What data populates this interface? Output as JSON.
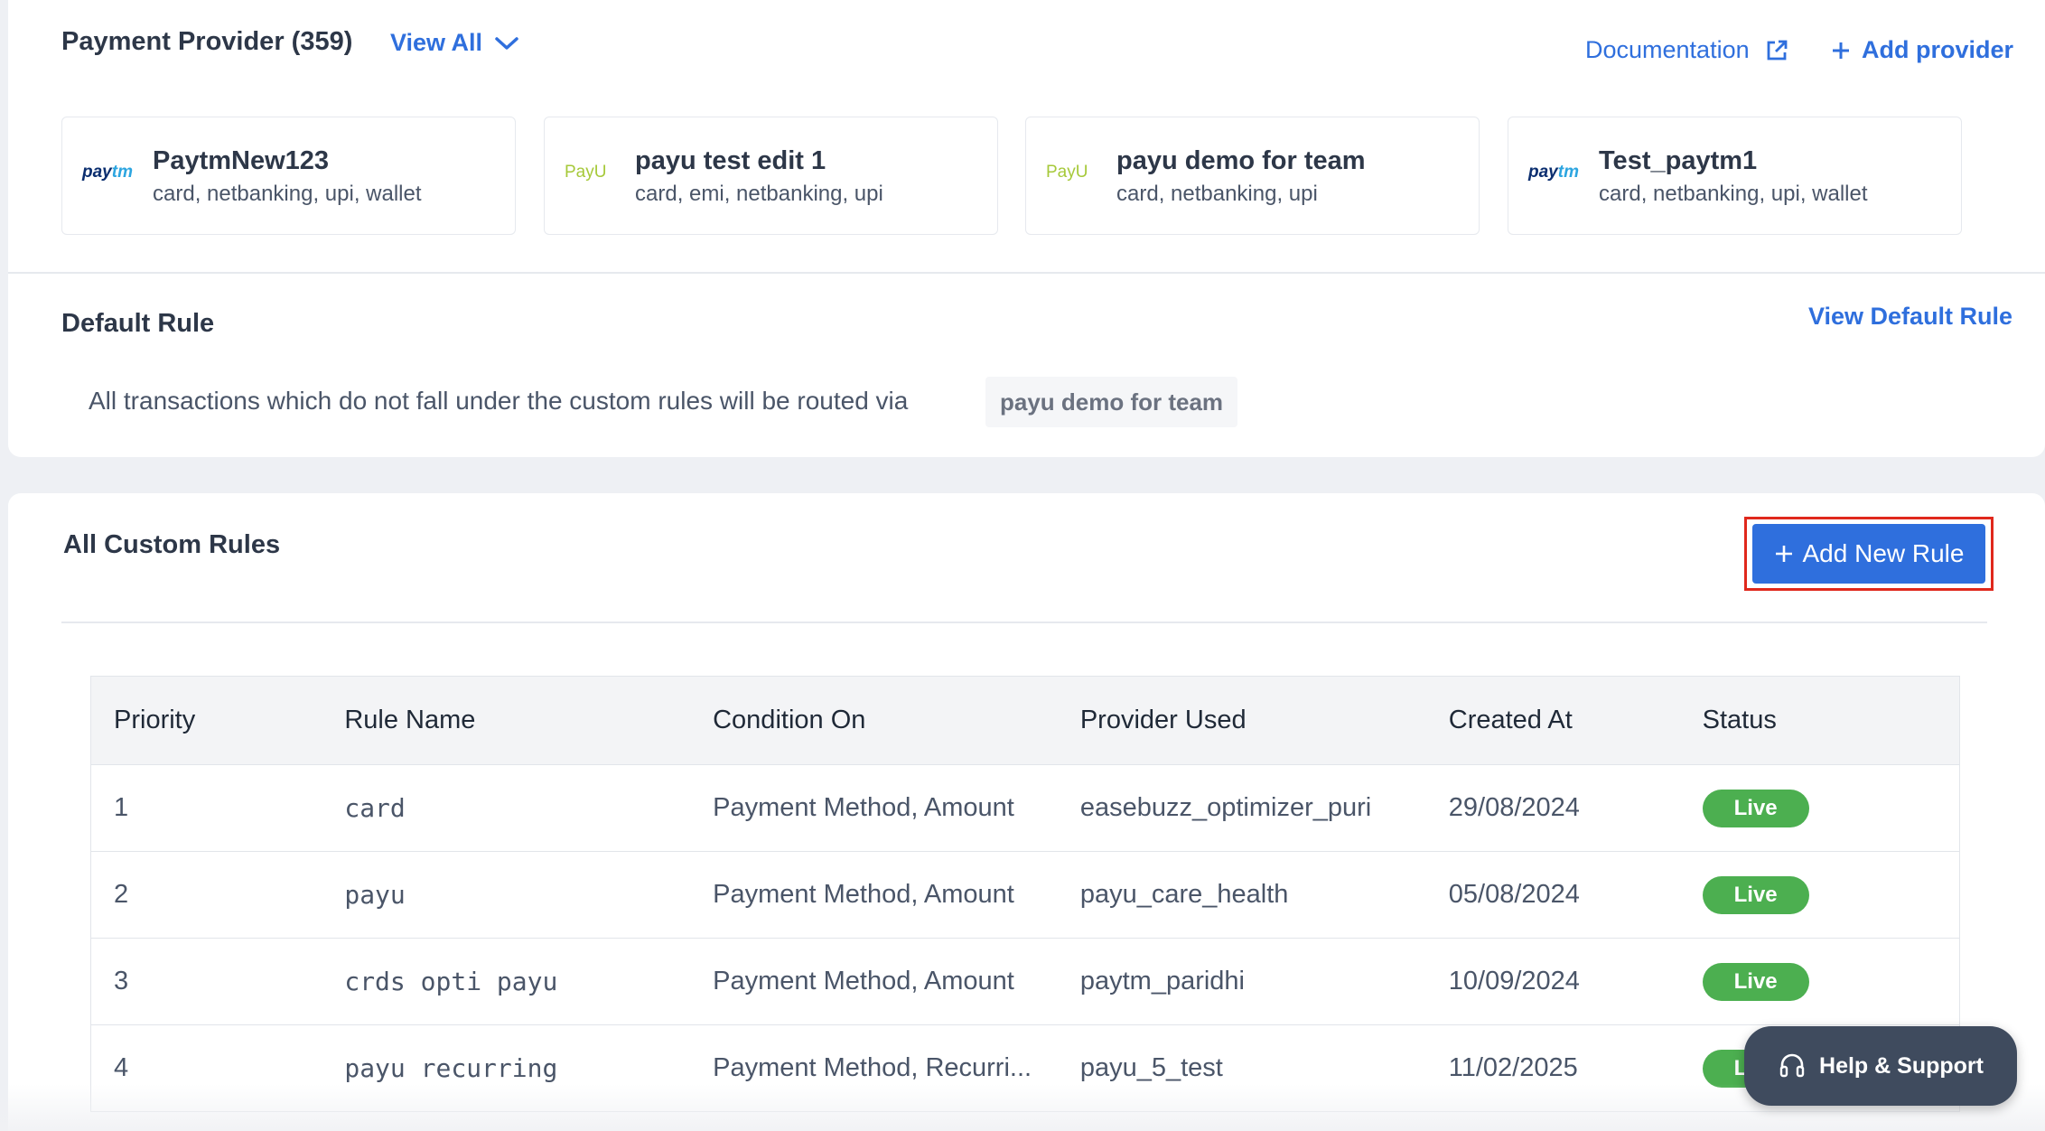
{
  "providers_section": {
    "title": "Payment Provider (359)",
    "view_all": "View All",
    "documentation": "Documentation",
    "add_provider": "Add provider",
    "providers": [
      {
        "logo": "paytm",
        "name": "PaytmNew123",
        "methods": "card, netbanking, upi, wallet"
      },
      {
        "logo": "payu",
        "name": "payu test edit 1",
        "methods": "card, emi, netbanking, upi"
      },
      {
        "logo": "payu",
        "name": "payu demo for team",
        "methods": "card, netbanking, upi"
      },
      {
        "logo": "paytm",
        "name": "Test_paytm1",
        "methods": "card, netbanking, upi, wallet"
      }
    ]
  },
  "default_rule": {
    "title": "Default Rule",
    "view_link": "View Default Rule",
    "description": "All transactions which do not fall under the custom rules will be routed via",
    "provider_chip": "payu demo for team"
  },
  "custom_rules": {
    "title": "All Custom Rules",
    "add_button": "Add New Rule",
    "columns": [
      "Priority",
      "Rule Name",
      "Condition On",
      "Provider Used",
      "Created At",
      "Status"
    ],
    "rows": [
      {
        "priority": "1",
        "name": "card",
        "condition": "Payment Method, Amount",
        "provider": "easebuzz_optimizer_puri",
        "created": "29/08/2024",
        "status": "Live"
      },
      {
        "priority": "2",
        "name": "payu",
        "condition": "Payment Method, Amount",
        "provider": "payu_care_health",
        "created": "05/08/2024",
        "status": "Live"
      },
      {
        "priority": "3",
        "name": "crds opti payu",
        "condition": "Payment Method, Amount",
        "provider": "paytm_paridhi",
        "created": "10/09/2024",
        "status": "Live"
      },
      {
        "priority": "4",
        "name": "payu recurring",
        "condition": "Payment Method, Recurri...",
        "provider": "payu_5_test",
        "created": "11/02/2025",
        "status": "Live"
      }
    ]
  },
  "help": {
    "label": "Help & Support"
  },
  "colors": {
    "accent": "#2f6fdd",
    "live": "#4caf50",
    "highlight": "#e0281c"
  },
  "logo_texts": {
    "paytm_a": "pay",
    "paytm_b": "tm",
    "payu": "PayU"
  }
}
